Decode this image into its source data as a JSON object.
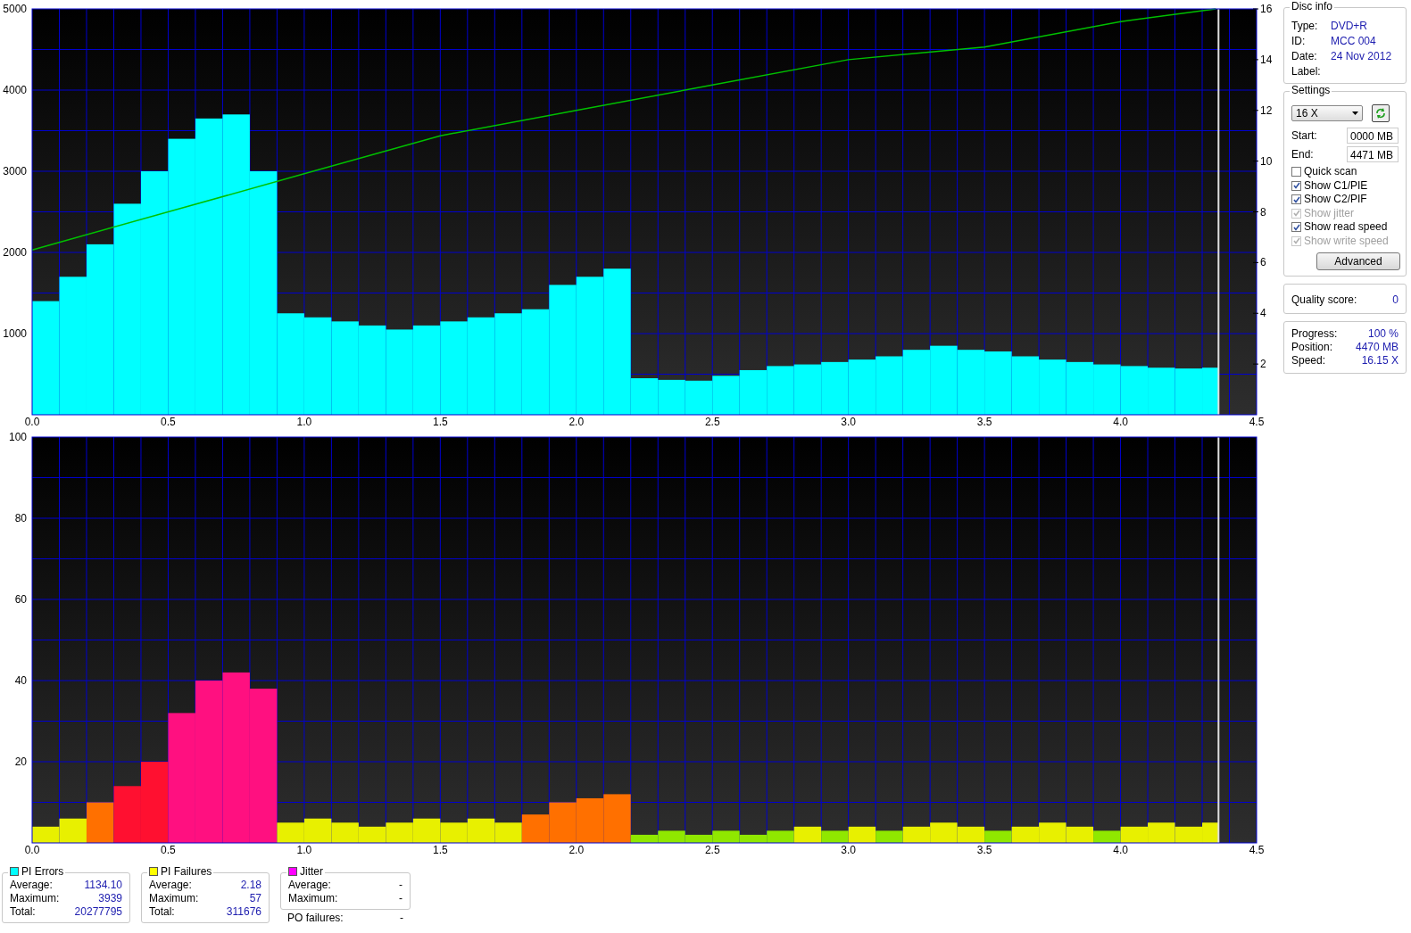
{
  "charts": [
    {
      "kind": "errors",
      "chart_data": {
        "type": "bar",
        "grid": true,
        "xlim": [
          0,
          4.5
        ],
        "ylim": [
          0,
          5000
        ],
        "y2lim": [
          0,
          16
        ],
        "y2ticks": [
          2,
          4,
          6,
          8,
          10,
          12,
          14,
          16
        ],
        "ref_lines": [
          {
            "axis": "x",
            "value": 4.36
          }
        ],
        "xticks": [
          {
            "value": 0,
            "label": "0.0"
          },
          {
            "value": 0.5,
            "label": "0.5"
          },
          {
            "value": 1,
            "label": "1.0"
          },
          {
            "value": 1.5,
            "label": "1.5"
          },
          {
            "value": 2,
            "label": "2.0"
          },
          {
            "value": 2.5,
            "label": "2.5"
          },
          {
            "value": 3,
            "label": "3.0"
          },
          {
            "value": 3.5,
            "label": "3.5"
          },
          {
            "value": 4,
            "label": "4.0"
          },
          {
            "value": 4.5,
            "label": "4.5"
          }
        ],
        "yticks": [
          1000,
          2000,
          3000,
          4000,
          5000
        ],
        "x": [
          0.05,
          0.15,
          0.25,
          0.35,
          0.45,
          0.55,
          0.65,
          0.75,
          0.85,
          0.95,
          1.05,
          1.15,
          1.25,
          1.35,
          1.45,
          1.55,
          1.65,
          1.75,
          1.85,
          1.95,
          2.05,
          2.15,
          2.25,
          2.35,
          2.45,
          2.55,
          2.65,
          2.75,
          2.85,
          2.95,
          3.05,
          3.15,
          3.25,
          3.35,
          3.45,
          3.55,
          3.65,
          3.75,
          3.85,
          3.95,
          4.05,
          4.15,
          4.25,
          4.35
        ],
        "series": [
          {
            "color": "#00ffff",
            "values": [
              1400,
              1700,
              2100,
              2600,
              3000,
              3400,
              3650,
              3700,
              3000,
              1250,
              1200,
              1150,
              1100,
              1050,
              1100,
              1150,
              1200,
              1250,
              1300,
              1600,
              1700,
              1800,
              450,
              430,
              420,
              480,
              550,
              600,
              620,
              650,
              680,
              720,
              800,
              850,
              800,
              780,
              720,
              680,
              650,
              620,
              600,
              580,
              570,
              580
            ]
          },
          {
            "color": "#00c000",
            "type": "line",
            "axis": "y2",
            "x": [
              0,
              0.5,
              1,
              1.5,
              2,
              2.5,
              3,
              3.5,
              4,
              4.35
            ],
            "values": [
              6.5,
              8,
              9.5,
              11,
              12,
              13,
              14,
              14.5,
              15.5,
              16
            ]
          }
        ]
      }
    },
    {
      "kind": "failures",
      "chart_data": {
        "type": "bar",
        "grid": true,
        "xlim": [
          0,
          4.5
        ],
        "ylim": [
          0,
          100
        ],
        "ref_lines": [
          {
            "axis": "x",
            "value": 4.36
          }
        ],
        "xticks": [
          {
            "value": 0,
            "label": "0.0"
          },
          {
            "value": 0.5,
            "label": "0.5"
          },
          {
            "value": 1,
            "label": "1.0"
          },
          {
            "value": 1.5,
            "label": "1.5"
          },
          {
            "value": 2,
            "label": "2.0"
          },
          {
            "value": 2.5,
            "label": "2.5"
          },
          {
            "value": 3,
            "label": "3.0"
          },
          {
            "value": 3.5,
            "label": "3.5"
          },
          {
            "value": 4,
            "label": "4.0"
          },
          {
            "value": 4.5,
            "label": "4.5"
          }
        ],
        "yticks": [
          20,
          40,
          60,
          80,
          100
        ],
        "x": [
          0.05,
          0.15,
          0.25,
          0.35,
          0.45,
          0.55,
          0.65,
          0.75,
          0.85,
          0.95,
          1.05,
          1.15,
          1.25,
          1.35,
          1.45,
          1.55,
          1.65,
          1.75,
          1.85,
          1.95,
          2.05,
          2.15,
          2.25,
          2.35,
          2.45,
          2.55,
          2.65,
          2.75,
          2.85,
          2.95,
          3.05,
          3.15,
          3.25,
          3.35,
          3.45,
          3.55,
          3.65,
          3.75,
          3.85,
          3.95,
          4.05,
          4.15,
          4.25,
          4.35
        ],
        "series": [
          {
            "values": [
              4,
              6,
              10,
              14,
              20,
              32,
              40,
              42,
              38,
              5,
              6,
              5,
              4,
              5,
              6,
              5,
              6,
              5,
              7,
              10,
              11,
              12,
              2,
              3,
              2,
              3,
              2,
              3,
              4,
              3,
              4,
              3,
              4,
              5,
              4,
              3,
              4,
              5,
              4,
              3,
              4,
              5,
              4,
              5
            ]
          }
        ]
      }
    }
  ],
  "disc_info": {
    "title": "Disc info",
    "fields": [
      {
        "label": "Type:",
        "value": "DVD+R"
      },
      {
        "label": "ID:",
        "value": "MCC 004"
      },
      {
        "label": "Date:",
        "value": "24 Nov 2012"
      },
      {
        "label": "Label:"
      }
    ]
  },
  "settings": {
    "title": "Settings",
    "speed": "16 X",
    "start": {
      "label": "Start:",
      "value": "0000 MB"
    },
    "end": {
      "label": "End:",
      "value": "4471 MB"
    },
    "options": [
      {
        "label": "Quick scan",
        "checked": false,
        "disabled": false
      },
      {
        "label": "Show C1/PIE",
        "checked": true,
        "disabled": false
      },
      {
        "label": "Show C2/PIF",
        "checked": true,
        "disabled": false
      },
      {
        "label": "Show jitter",
        "checked": true,
        "disabled": true
      },
      {
        "label": "Show read speed",
        "checked": true,
        "disabled": false
      },
      {
        "label": "Show write speed",
        "checked": true,
        "disabled": true
      }
    ],
    "advanced_button": "Advanced"
  },
  "quality": {
    "label": "Quality score:",
    "value": "0"
  },
  "progress": [
    {
      "label": "Progress:",
      "value": "100 %"
    },
    {
      "label": "Position:",
      "value": "4470 MB"
    },
    {
      "label": "Speed:",
      "value": "16.15 X"
    }
  ],
  "stats": [
    {
      "title": "PI Errors",
      "color": "#00ffff",
      "rows": [
        {
          "label": "Average:",
          "value": "1134.10"
        },
        {
          "label": "Maximum:",
          "value": "3939"
        },
        {
          "label": "Total:",
          "value": "20277795"
        }
      ]
    },
    {
      "title": "PI Failures",
      "color": "#ffff00",
      "rows": [
        {
          "label": "Average:",
          "value": "2.18"
        },
        {
          "label": "Maximum:",
          "value": "57"
        },
        {
          "label": "Total:",
          "value": "311676"
        }
      ]
    },
    {
      "title": "Jitter",
      "color": "#ff00ff",
      "rows": [
        {
          "label": "Average:",
          "value": "-"
        },
        {
          "label": "Maximum:",
          "value": "-"
        }
      ]
    }
  ],
  "po_failures": {
    "label": "PO failures:",
    "value": "-"
  }
}
